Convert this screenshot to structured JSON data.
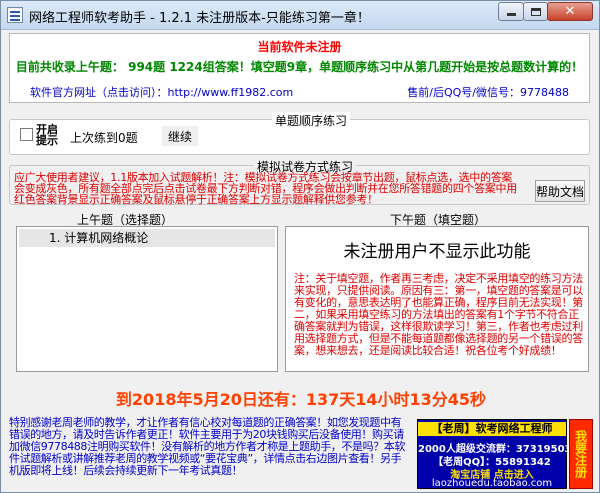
{
  "window": {
    "title": "网络工程师软考助手 - 1.2.1 未注册版本-只能练习第一章！",
    "close_glyph": "✕"
  },
  "info": {
    "unregistered": "当前软件未注册",
    "collected": "目前共收录上午题： 994题 1224组答案！填空题9章，单题顺序练习中从第几题开始是按总题数计算的！",
    "website_label": "软件官方网址（点击访问）：",
    "website_url": "http://www.ff1982.com",
    "qq": "售前/后QQ号/微信号：9778488"
  },
  "sequential": {
    "title": "单题顺序练习",
    "checkbox_label": "开启提示",
    "last_practice": "上次练到0题",
    "continue_label": "继续"
  },
  "simulation": {
    "title": "模拟试卷方式练习",
    "text": "应广大使用者建议，1.1版本加入试题解析！注：模拟试卷方式练习会按章节出题，鼠标点选，选中的答案会变成灰色，所有题全部点完后点击试卷最下方判断对错，程序会做出判断并在您所答错题的四个答案中用红色答案背景显示正确答案及鼠标悬停于正确答案上方显示题解释供您参考！",
    "help_label": "帮助文档"
  },
  "am_exam": {
    "title": "上午题（选择题）",
    "items": [
      "1. 计算机网络概论"
    ]
  },
  "pm_exam": {
    "title": "下午题（填空题）",
    "notice": "未注册用户不显示此功能",
    "note": "注：关于填空题，作者再三考虑，决定不采用填空的练习方法来实现，只提供阅读。原因有三：第一，填空题的答案是可以有变化的，意思表达明了也能算正确，程序目前无法实现！第二，如果采用填空练习的方法填出的答案有1个字节不符合正确答案就判为错误，这样很欺读学习！第三，作者也考虑过利用选择题方式，但是不能每道题都像选择题的另一个错误的答案，想来想去，还是阅读比较合适！祝各位考个好成绩！"
  },
  "countdown": "到2018年5月20日还有：137天14小时13分45秒",
  "bottom": {
    "note": "特别感谢老周老师的教学，才让作者有信心校对每道题的正确答案！如您发现题中有错误的地方，请及时告诉作者更正！软件主要用于为20块钱购买后没备使用！购买请加微信9778488注明购买软件！没有解析的地方作者才称是上题助手，不是吗？本软件试题解析或讲解推荐老周的教学视频或“要花宝典”，详情点击右边图片查看！另手机版即将上线！后续会持续更新下一年考试真题！",
    "ad_title": "【老周】软考网络工程师",
    "ad_line1": "2000人超级交流群：373195039",
    "ad_line2": "【老周QQ】：55891342",
    "ad_line3": "淘宝店铺 点击进入",
    "ad_line4": "laozhouedu.taobao.com",
    "register_label": "我要注册"
  }
}
